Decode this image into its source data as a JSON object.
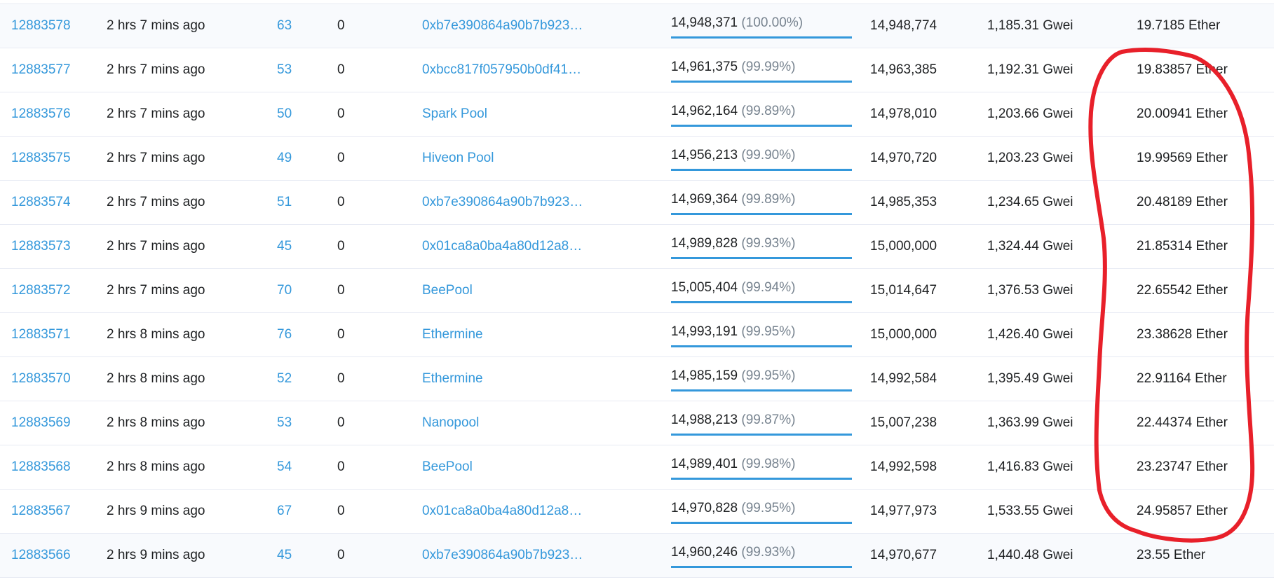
{
  "rows": [
    {
      "block": "12883578",
      "age": "2 hrs 7 mins ago",
      "txn": "63",
      "uncles": "0",
      "miner": "0xb7e390864a90b7b923…",
      "gas_used": "14,948,371",
      "gas_pct": "(100.00%)",
      "gas_pct_value": 100.0,
      "gas_limit": "14,948,774",
      "avg_gas_price": "1,185.31 Gwei",
      "reward": "19.7185 Ether"
    },
    {
      "block": "12883577",
      "age": "2 hrs 7 mins ago",
      "txn": "53",
      "uncles": "0",
      "miner": "0xbcc817f057950b0df41…",
      "gas_used": "14,961,375",
      "gas_pct": "(99.99%)",
      "gas_pct_value": 99.99,
      "gas_limit": "14,963,385",
      "avg_gas_price": "1,192.31 Gwei",
      "reward": "19.83857 Ether"
    },
    {
      "block": "12883576",
      "age": "2 hrs 7 mins ago",
      "txn": "50",
      "uncles": "0",
      "miner": "Spark Pool",
      "gas_used": "14,962,164",
      "gas_pct": "(99.89%)",
      "gas_pct_value": 99.89,
      "gas_limit": "14,978,010",
      "avg_gas_price": "1,203.66 Gwei",
      "reward": "20.00941 Ether"
    },
    {
      "block": "12883575",
      "age": "2 hrs 7 mins ago",
      "txn": "49",
      "uncles": "0",
      "miner": "Hiveon Pool",
      "gas_used": "14,956,213",
      "gas_pct": "(99.90%)",
      "gas_pct_value": 99.9,
      "gas_limit": "14,970,720",
      "avg_gas_price": "1,203.23 Gwei",
      "reward": "19.99569 Ether"
    },
    {
      "block": "12883574",
      "age": "2 hrs 7 mins ago",
      "txn": "51",
      "uncles": "0",
      "miner": "0xb7e390864a90b7b923…",
      "gas_used": "14,969,364",
      "gas_pct": "(99.89%)",
      "gas_pct_value": 99.89,
      "gas_limit": "14,985,353",
      "avg_gas_price": "1,234.65 Gwei",
      "reward": "20.48189 Ether"
    },
    {
      "block": "12883573",
      "age": "2 hrs 7 mins ago",
      "txn": "45",
      "uncles": "0",
      "miner": "0x01ca8a0ba4a80d12a8…",
      "gas_used": "14,989,828",
      "gas_pct": "(99.93%)",
      "gas_pct_value": 99.93,
      "gas_limit": "15,000,000",
      "avg_gas_price": "1,324.44 Gwei",
      "reward": "21.85314 Ether"
    },
    {
      "block": "12883572",
      "age": "2 hrs 7 mins ago",
      "txn": "70",
      "uncles": "0",
      "miner": "BeePool",
      "gas_used": "15,005,404",
      "gas_pct": "(99.94%)",
      "gas_pct_value": 99.94,
      "gas_limit": "15,014,647",
      "avg_gas_price": "1,376.53 Gwei",
      "reward": "22.65542 Ether"
    },
    {
      "block": "12883571",
      "age": "2 hrs 8 mins ago",
      "txn": "76",
      "uncles": "0",
      "miner": "Ethermine",
      "gas_used": "14,993,191",
      "gas_pct": "(99.95%)",
      "gas_pct_value": 99.95,
      "gas_limit": "15,000,000",
      "avg_gas_price": "1,426.40 Gwei",
      "reward": "23.38628 Ether"
    },
    {
      "block": "12883570",
      "age": "2 hrs 8 mins ago",
      "txn": "52",
      "uncles": "0",
      "miner": "Ethermine",
      "gas_used": "14,985,159",
      "gas_pct": "(99.95%)",
      "gas_pct_value": 99.95,
      "gas_limit": "14,992,584",
      "avg_gas_price": "1,395.49 Gwei",
      "reward": "22.91164 Ether"
    },
    {
      "block": "12883569",
      "age": "2 hrs 8 mins ago",
      "txn": "53",
      "uncles": "0",
      "miner": "Nanopool",
      "gas_used": "14,988,213",
      "gas_pct": "(99.87%)",
      "gas_pct_value": 99.87,
      "gas_limit": "15,007,238",
      "avg_gas_price": "1,363.99 Gwei",
      "reward": "22.44374 Ether"
    },
    {
      "block": "12883568",
      "age": "2 hrs 8 mins ago",
      "txn": "54",
      "uncles": "0",
      "miner": "BeePool",
      "gas_used": "14,989,401",
      "gas_pct": "(99.98%)",
      "gas_pct_value": 99.98,
      "gas_limit": "14,992,598",
      "avg_gas_price": "1,416.83 Gwei",
      "reward": "23.23747 Ether"
    },
    {
      "block": "12883567",
      "age": "2 hrs 9 mins ago",
      "txn": "67",
      "uncles": "0",
      "miner": "0x01ca8a0ba4a80d12a8…",
      "gas_used": "14,970,828",
      "gas_pct": "(99.95%)",
      "gas_pct_value": 99.95,
      "gas_limit": "14,977,973",
      "avg_gas_price": "1,533.55 Gwei",
      "reward": "24.95857 Ether"
    },
    {
      "block": "12883566",
      "age": "2 hrs 9 mins ago",
      "txn": "45",
      "uncles": "0",
      "miner": "0xb7e390864a90b7b923…",
      "gas_used": "14,960,246",
      "gas_pct": "(99.93%)",
      "gas_pct_value": 99.93,
      "gas_limit": "14,970,677",
      "avg_gas_price": "1,440.48 Gwei",
      "reward": "23.55 Ether"
    }
  ],
  "colors": {
    "link": "#3498db",
    "text": "#1e2022",
    "muted": "#77838f",
    "bar": "#3498db",
    "row_border": "#e7eaf3",
    "annotation": "#e8202a"
  },
  "annotation": {
    "shape": "hand-drawn-loop",
    "target": "reward-column",
    "rows_covered": "12883577-12883567"
  }
}
